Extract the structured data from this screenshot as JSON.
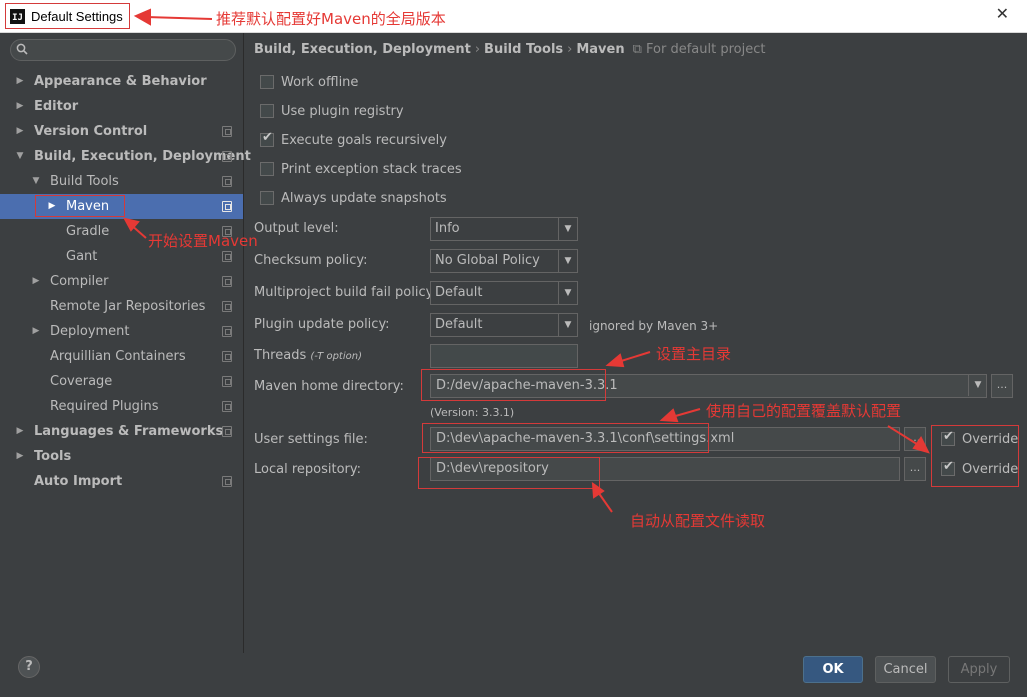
{
  "window": {
    "title": "Default Settings",
    "icon_text": "IJ",
    "close_symbol": "✕"
  },
  "search": {
    "icon": "search-icon"
  },
  "tree": [
    {
      "label": "Appearance & Behavior"
    },
    {
      "label": "Editor"
    },
    {
      "label": "Version Control"
    },
    {
      "label": "Build, Execution, Deployment"
    },
    {
      "label": "Build Tools"
    },
    {
      "label": "Maven"
    },
    {
      "label": "Gradle"
    },
    {
      "label": "Gant"
    },
    {
      "label": "Compiler"
    },
    {
      "label": "Remote Jar Repositories"
    },
    {
      "label": "Deployment"
    },
    {
      "label": "Arquillian Containers"
    },
    {
      "label": "Coverage"
    },
    {
      "label": "Required Plugins"
    },
    {
      "label": "Languages & Frameworks"
    },
    {
      "label": "Tools"
    },
    {
      "label": "Auto Import"
    }
  ],
  "breadcrumb": {
    "parts": [
      "Build, Execution, Deployment",
      "Build Tools",
      "Maven"
    ],
    "separator": "›",
    "scope": "For default project"
  },
  "options": {
    "work_offline": "Work offline",
    "use_plugin_registry": "Use plugin registry",
    "execute_goals_recursively": "Execute goals recursively",
    "print_exception_stack_traces": "Print exception stack traces",
    "always_update_snapshots": "Always update snapshots"
  },
  "fields": {
    "output_level": {
      "label": "Output level:",
      "value": "Info"
    },
    "checksum_policy": {
      "label": "Checksum policy:",
      "value": "No Global Policy"
    },
    "multiproject_fail_policy": {
      "label": "Multiproject build fail policy:",
      "value": "Default"
    },
    "plugin_update_policy": {
      "label": "Plugin update policy:",
      "value": "Default",
      "note": "ignored by Maven 3+"
    },
    "threads": {
      "label": "Threads",
      "hint": "(-T option)",
      "value": ""
    },
    "maven_home": {
      "label": "Maven home directory:",
      "value": "D:/dev/apache-maven-3.3.1",
      "version": "(Version: 3.3.1)"
    },
    "user_settings": {
      "label": "User settings file:",
      "value": "D:\\dev\\apache-maven-3.3.1\\conf\\settings.xml",
      "override": "Override"
    },
    "local_repo": {
      "label": "Local repository:",
      "value": "D:\\dev\\repository",
      "override": "Override"
    },
    "browse_label": "..."
  },
  "buttons": {
    "help": "?",
    "ok": "OK",
    "cancel": "Cancel",
    "apply": "Apply"
  },
  "annotations": {
    "title_note": "推荐默认配置好Maven的全局版本",
    "maven_note": "开始设置Maven",
    "home_note": "设置主目录",
    "settings_note": "使用自己的配置覆盖默认配置",
    "repo_note": "自动从配置文件读取"
  },
  "colors": {
    "annotation": "#e53935",
    "selection": "#4b6eaf",
    "background": "#3c3f41"
  }
}
